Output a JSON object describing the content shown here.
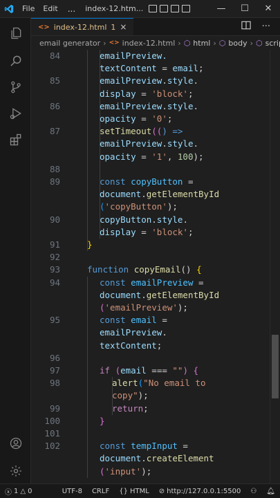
{
  "titlebar": {
    "menu": [
      "File",
      "Edit"
    ],
    "more": "...",
    "title": "index-12.htm...",
    "window_controls": {
      "minimize": "—",
      "maximize": "☐",
      "close": "✕"
    }
  },
  "tab": {
    "name": "index-12.html",
    "modified_count": "1",
    "close": "×"
  },
  "breadcrumb": {
    "items": [
      "email generator",
      "index-12.html",
      "html",
      "body",
      "script"
    ]
  },
  "editor": {
    "lines": [
      {
        "n": "84",
        "segs": [
          [
            "emailPreview.",
            "prop"
          ]
        ],
        "cont": true
      },
      {
        "n": "",
        "segs": [
          [
            "textContent",
            "prop"
          ],
          [
            " = ",
            "op"
          ],
          [
            "email",
            "var"
          ],
          [
            ";",
            "punct"
          ]
        ]
      },
      {
        "n": "85",
        "segs": [
          [
            "emailPreview",
            "var"
          ],
          [
            ".",
            "punct"
          ],
          [
            "style",
            "prop"
          ],
          [
            ".",
            "punct"
          ]
        ]
      },
      {
        "n": "",
        "segs": [
          [
            "display",
            "prop"
          ],
          [
            " = ",
            "op"
          ],
          [
            "'block'",
            "string"
          ],
          [
            ";",
            "punct"
          ]
        ]
      },
      {
        "n": "86",
        "segs": [
          [
            "emailPreview",
            "var"
          ],
          [
            ".",
            "punct"
          ],
          [
            "style",
            "prop"
          ],
          [
            ".",
            "punct"
          ]
        ]
      },
      {
        "n": "",
        "segs": [
          [
            "opacity",
            "prop"
          ],
          [
            " = ",
            "op"
          ],
          [
            "'0'",
            "string"
          ],
          [
            ";",
            "punct"
          ]
        ]
      },
      {
        "n": "87",
        "segs": [
          [
            "setTimeout",
            "func"
          ],
          [
            "((",
            "brace2"
          ],
          [
            ") =>",
            "keyword"
          ]
        ]
      },
      {
        "n": "",
        "segs": [
          [
            "emailPreview",
            "var"
          ],
          [
            ".",
            "punct"
          ],
          [
            "style",
            "prop"
          ],
          [
            ".",
            "punct"
          ]
        ]
      },
      {
        "n": "",
        "segs": [
          [
            "opacity",
            "prop"
          ],
          [
            " = ",
            "op"
          ],
          [
            "'1'",
            "string"
          ],
          [
            ", ",
            "punct"
          ],
          [
            "100",
            "num"
          ],
          [
            ");",
            "punct"
          ]
        ]
      },
      {
        "n": "88",
        "segs": []
      },
      {
        "n": "89",
        "segs": [
          [
            "const",
            "keyword"
          ],
          [
            " ",
            "op"
          ],
          [
            "copyButton",
            "const"
          ],
          [
            " =",
            "op"
          ]
        ]
      },
      {
        "n": "",
        "segs": [
          [
            "document",
            "var"
          ],
          [
            ".",
            "punct"
          ],
          [
            "getElementById",
            "func"
          ]
        ]
      },
      {
        "n": "",
        "segs": [
          [
            "(",
            "brace3"
          ],
          [
            "'copyButton'",
            "string"
          ],
          [
            ");",
            "punct"
          ]
        ]
      },
      {
        "n": "90",
        "segs": [
          [
            "copyButton",
            "var"
          ],
          [
            ".",
            "punct"
          ],
          [
            "style",
            "prop"
          ],
          [
            ".",
            "punct"
          ]
        ]
      },
      {
        "n": "",
        "segs": [
          [
            "display",
            "prop"
          ],
          [
            " = ",
            "op"
          ],
          [
            "'block'",
            "string"
          ],
          [
            ";",
            "punct"
          ]
        ]
      },
      {
        "n": "91",
        "segs": [
          [
            "}",
            "brace1"
          ]
        ]
      },
      {
        "n": "92",
        "segs": []
      },
      {
        "n": "93",
        "segs": [
          [
            "function",
            "keyword"
          ],
          [
            " ",
            "op"
          ],
          [
            "copyEmail",
            "func"
          ],
          [
            "() ",
            "punct"
          ],
          [
            "{",
            "brace1"
          ]
        ]
      },
      {
        "n": "94",
        "segs": [
          [
            "const",
            "keyword"
          ],
          [
            " ",
            "op"
          ],
          [
            "emailPreview",
            "const"
          ],
          [
            " =",
            "op"
          ]
        ]
      },
      {
        "n": "",
        "segs": [
          [
            "document",
            "var"
          ],
          [
            ".",
            "punct"
          ],
          [
            "getElementById",
            "func"
          ]
        ]
      },
      {
        "n": "",
        "segs": [
          [
            "(",
            "brace2"
          ],
          [
            "'emailPreview'",
            "string"
          ],
          [
            ");",
            "punct"
          ]
        ]
      },
      {
        "n": "95",
        "segs": [
          [
            "const",
            "keyword"
          ],
          [
            " ",
            "op"
          ],
          [
            "email",
            "const"
          ],
          [
            " =",
            "op"
          ]
        ]
      },
      {
        "n": "",
        "segs": [
          [
            "emailPreview",
            "var"
          ],
          [
            ".",
            "punct"
          ]
        ]
      },
      {
        "n": "",
        "segs": [
          [
            "textContent",
            "prop"
          ],
          [
            ";",
            "punct"
          ]
        ]
      },
      {
        "n": "96",
        "segs": []
      },
      {
        "n": "97",
        "segs": [
          [
            "if",
            "control"
          ],
          [
            " (",
            "brace2"
          ],
          [
            "email",
            "var"
          ],
          [
            " === ",
            "op"
          ],
          [
            "\"\"",
            "string"
          ],
          [
            ") ",
            "brace2"
          ],
          [
            "{",
            "brace2"
          ]
        ]
      },
      {
        "n": "98",
        "segs": [
          [
            "alert",
            "func"
          ],
          [
            "(",
            "brace3"
          ],
          [
            "\"No email to",
            "string"
          ]
        ]
      },
      {
        "n": "",
        "segs": [
          [
            "copy\"",
            "string"
          ],
          [
            ");",
            "punct"
          ]
        ]
      },
      {
        "n": "99",
        "segs": [
          [
            "return",
            "control"
          ],
          [
            ";",
            "punct"
          ]
        ]
      },
      {
        "n": "100",
        "segs": [
          [
            "}",
            "brace2"
          ]
        ]
      },
      {
        "n": "101",
        "segs": []
      },
      {
        "n": "102",
        "segs": [
          [
            "const",
            "keyword"
          ],
          [
            " ",
            "op"
          ],
          [
            "tempInput",
            "const"
          ],
          [
            " =",
            "op"
          ]
        ]
      },
      {
        "n": "",
        "segs": [
          [
            "document",
            "var"
          ],
          [
            ".",
            "punct"
          ],
          [
            "createElement",
            "func"
          ]
        ]
      },
      {
        "n": "",
        "segs": [
          [
            "(",
            "brace2"
          ],
          [
            "'input'",
            "string"
          ],
          [
            ");",
            "punct"
          ]
        ]
      }
    ]
  },
  "statusbar": {
    "errors": "1",
    "warnings": "0",
    "encoding": "UTF-8",
    "eol": "CRLF",
    "language": "HTML",
    "live_server": "http://127.0.0.1:5500"
  },
  "colors": {
    "accent": "#0078d4",
    "background": "#1f1f1f",
    "html_icon": "#e37933",
    "modified_tab": "#e2c08d"
  }
}
